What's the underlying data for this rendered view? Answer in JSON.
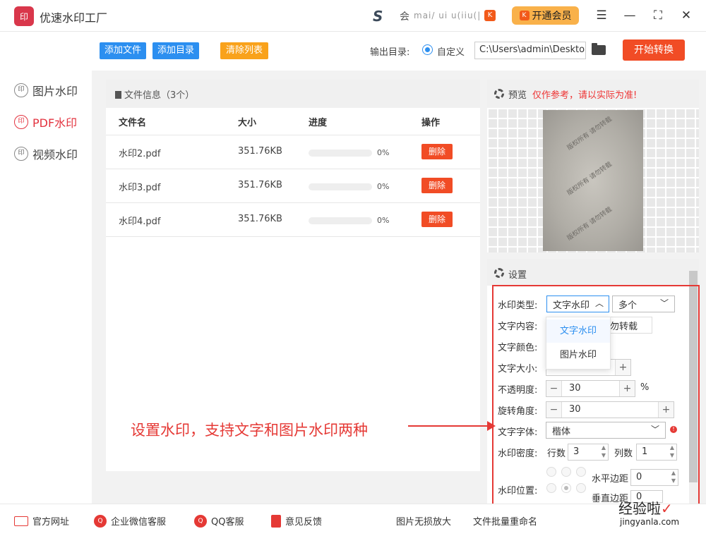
{
  "app": {
    "title": "优速水印工厂",
    "logo_text": "印",
    "user_prefix": "会",
    "user_id": "mai/ ui u(iiu(|",
    "vip_label": "开通会员"
  },
  "window_controls": [
    "menu-icon",
    "minimize-icon",
    "fullscreen-icon",
    "close-icon"
  ],
  "sidebar": {
    "items": [
      {
        "label": "图片水印",
        "active": false
      },
      {
        "label": "PDF水印",
        "active": true
      },
      {
        "label": "视频水印",
        "active": false
      }
    ]
  },
  "toolbar": {
    "add_file": "添加文件",
    "add_dir": "添加目录",
    "clear_list": "清除列表",
    "output_label": "输出目录:",
    "custom_label": "自定义",
    "output_path": "C:\\Users\\admin\\Desktop",
    "start_label": "开始转换"
  },
  "files": {
    "header": "文件信息（3个）",
    "columns": [
      "文件名",
      "大小",
      "进度",
      "操作"
    ],
    "rows": [
      {
        "name": "水印2.pdf",
        "size": "351.76KB",
        "progress": "0%",
        "action": "删除"
      },
      {
        "name": "水印3.pdf",
        "size": "351.76KB",
        "progress": "0%",
        "action": "删除"
      },
      {
        "name": "水印4.pdf",
        "size": "351.76KB",
        "progress": "0%",
        "action": "删除"
      }
    ]
  },
  "preview": {
    "label": "预览",
    "warning": "仅作参考，请以实际为准!",
    "watermark_text": "版权所有 请勿转载"
  },
  "settings": {
    "label": "设置",
    "type_label": "水印类型:",
    "type_value": "文字水印",
    "count_value": "多个",
    "dropdown_options": [
      "文字水印",
      "图片水印"
    ],
    "content_label": "文字内容:",
    "content_value": "勿转载",
    "color_label": "文字颜色:",
    "size_label": "文字大小:",
    "opacity_label": "不透明度:",
    "opacity_value": "30",
    "opacity_unit": "%",
    "rotate_label": "旋转角度:",
    "rotate_value": "30",
    "font_label": "文字字体:",
    "font_value": "楷体",
    "density_label": "水印密度:",
    "rows_label": "行数",
    "rows_value": "3",
    "cols_label": "列数",
    "cols_value": "1",
    "position_label": "水印位置:",
    "hmargin_label": "水平边距",
    "hmargin_value": "0",
    "vmargin_label": "垂直边距",
    "vmargin_value": "0"
  },
  "annotation": "设置水印，支持文字和图片水印两种",
  "footer": {
    "items": [
      "官方网址",
      "企业微信客服",
      "QQ客服",
      "意见反馈"
    ],
    "links": [
      "图片无损放大",
      "文件批量重命名"
    ]
  },
  "brand": {
    "name": "经验啦",
    "url": "jingyanla.com"
  },
  "colors": {
    "accent_blue": "#2c8ff0",
    "accent_red": "#f14c25",
    "annotation_red": "#e53935",
    "clear_orange": "#f9a21b"
  }
}
